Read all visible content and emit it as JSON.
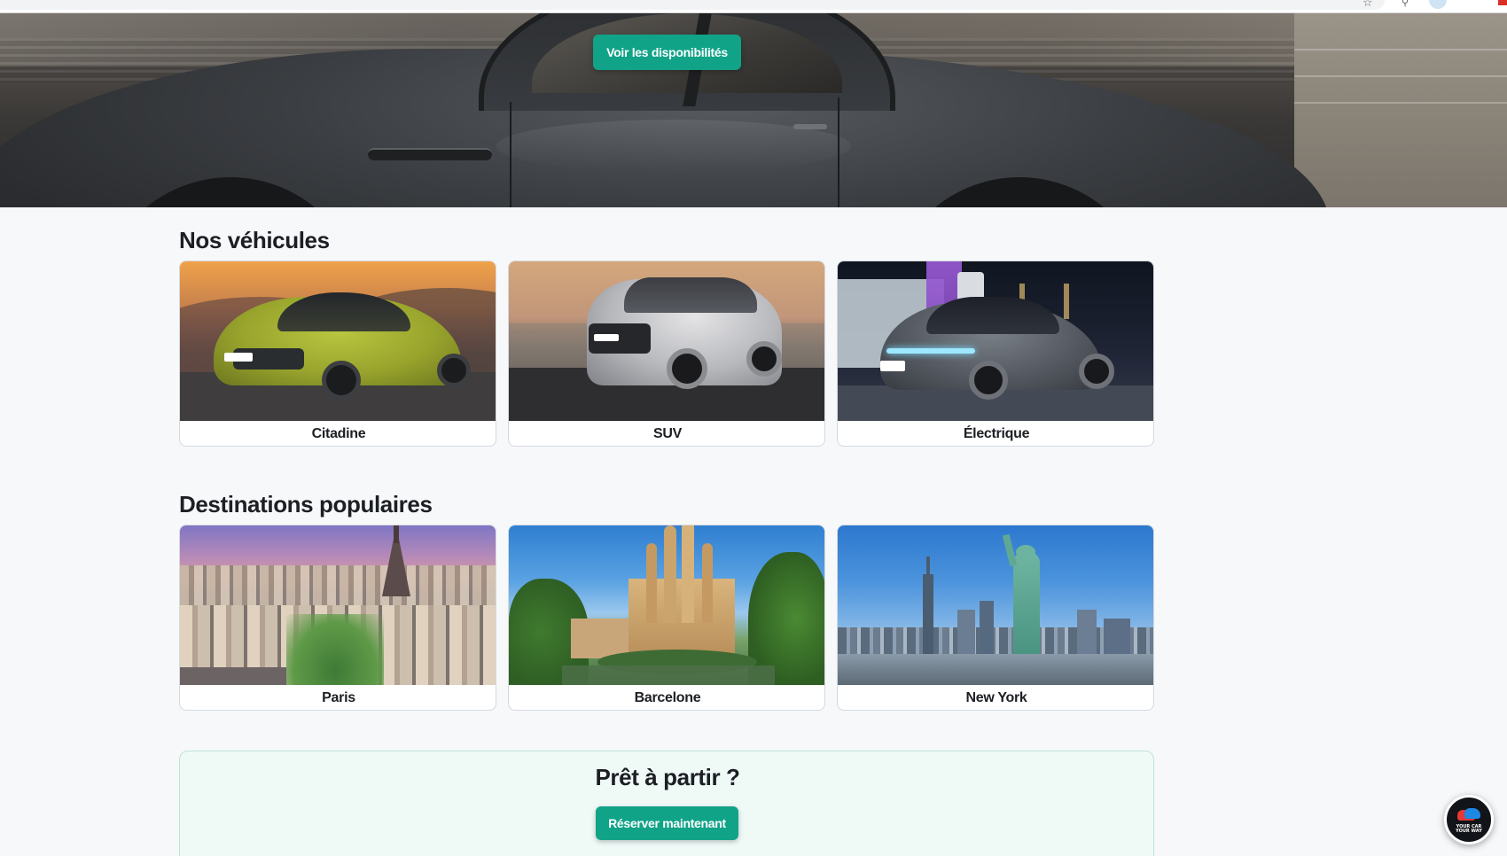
{
  "hero": {
    "cta_label": "Voir les disponibilités"
  },
  "vehicles": {
    "title": "Nos véhicules",
    "items": [
      {
        "label": "Citadine"
      },
      {
        "label": "SUV"
      },
      {
        "label": "Électrique"
      }
    ]
  },
  "destinations": {
    "title": "Destinations populaires",
    "items": [
      {
        "label": "Paris"
      },
      {
        "label": "Barcelone"
      },
      {
        "label": "New York"
      }
    ]
  },
  "cta": {
    "title": "Prêt à partir ?",
    "button_label": "Réserver maintenant"
  },
  "chat_badge": {
    "logo_text_line1": "YOUR CAR",
    "logo_text_line2": "YOUR WAY"
  },
  "colors": {
    "accent": "#11a388",
    "page_bg": "#f7f8f9",
    "cta_bg": "#effaf7"
  }
}
